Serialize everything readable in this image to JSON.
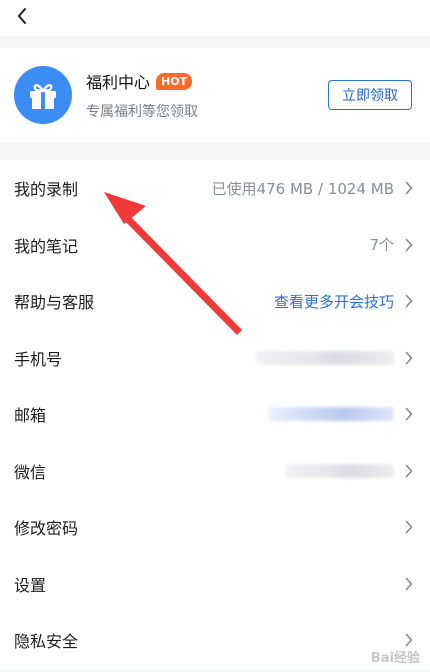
{
  "welfare": {
    "title": "福利中心",
    "badge": "HOT",
    "subtitle": "专属福利等您领取",
    "button_label": "立即领取"
  },
  "menu": [
    {
      "label": "我的录制",
      "value": "已使用476 MB / 1024 MB"
    },
    {
      "label": "我的笔记",
      "value": "7个"
    },
    {
      "label": "帮助与客服",
      "value": "查看更多开会技巧"
    },
    {
      "label": "手机号",
      "value": ""
    },
    {
      "label": "邮箱",
      "value": ""
    },
    {
      "label": "微信",
      "value": ""
    },
    {
      "label": "修改密码",
      "value": ""
    },
    {
      "label": "设置",
      "value": ""
    },
    {
      "label": "隐私安全",
      "value": ""
    }
  ],
  "colors": {
    "accent": "#2b6fe0",
    "hot": "#ff6a2b",
    "gift_bg": "#3b8cf5",
    "annotation_arrow": "#f03a3a"
  },
  "watermark": "Bai经验"
}
